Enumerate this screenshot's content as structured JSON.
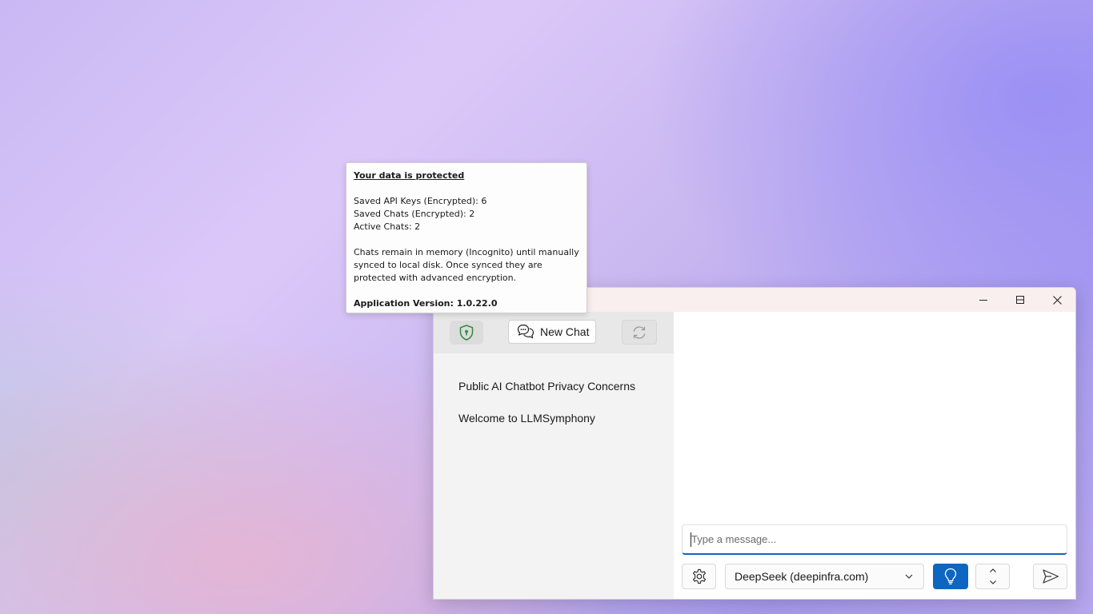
{
  "tooltip": {
    "title": "Your data is protected",
    "line_api_keys": "Saved API Keys (Encrypted): 6",
    "line_saved_chats": "Saved Chats (Encrypted): 2",
    "line_active_chats": "Active Chats: 2",
    "description": "Chats remain in memory (Incognito) until manually synced to local disk. Once synced they are protected with advanced encryption.",
    "version": "Application Version: 1.0.22.0"
  },
  "window": {
    "controls": {
      "minimize": "minimize-icon",
      "maximize": "maximize-icon",
      "close": "close-icon"
    }
  },
  "sidebar": {
    "new_chat_label": "New Chat",
    "chats": [
      {
        "title": "Public AI Chatbot Privacy Concerns"
      },
      {
        "title": "Welcome to LLMSymphony"
      }
    ]
  },
  "composer": {
    "placeholder": "Type a message...",
    "model": "DeepSeek (deepinfra.com)"
  },
  "colors": {
    "accent": "#0d66c0",
    "shield": "#2e8b3a",
    "titlebar": "#f9efee"
  }
}
